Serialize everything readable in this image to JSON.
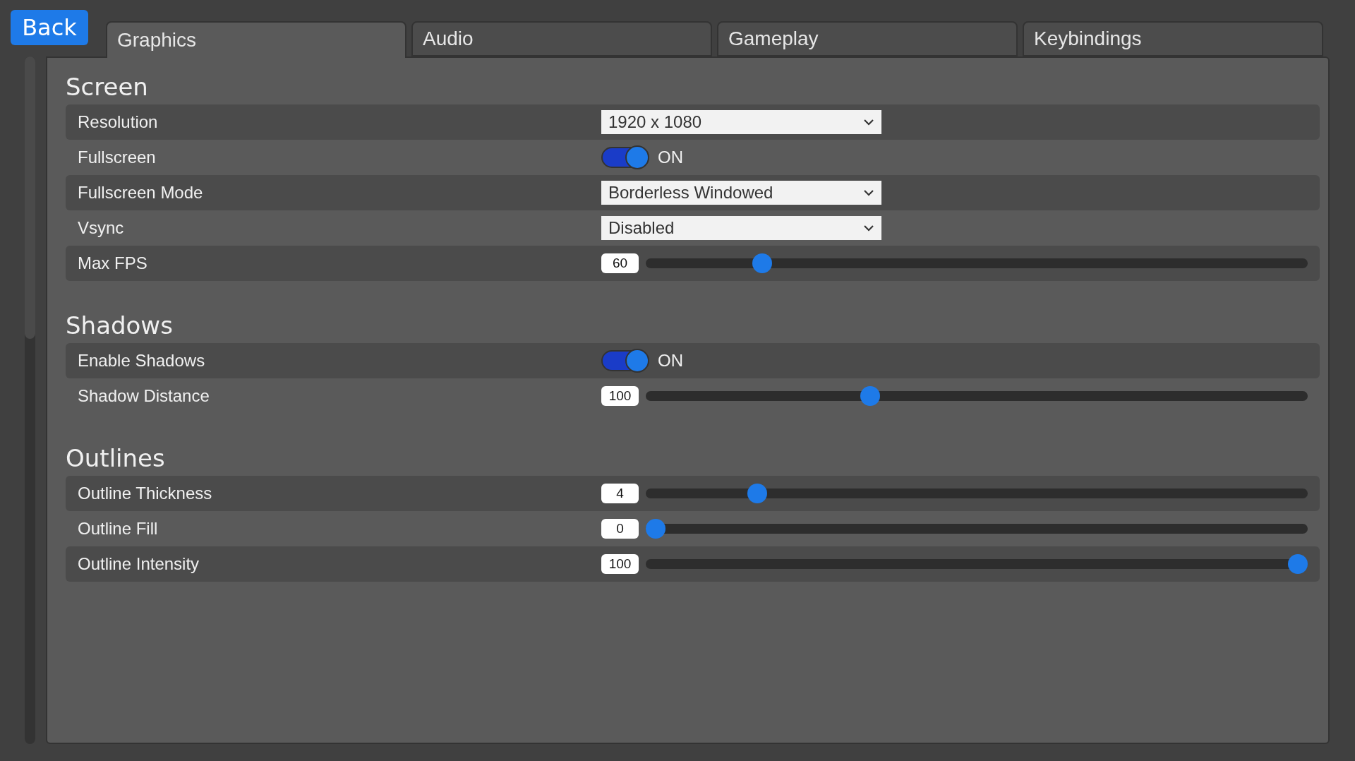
{
  "back_button": {
    "label": "Back"
  },
  "tabs": [
    {
      "label": "Graphics",
      "selected": true
    },
    {
      "label": "Audio",
      "selected": false
    },
    {
      "label": "Gameplay",
      "selected": false
    },
    {
      "label": "Keybindings",
      "selected": false
    }
  ],
  "sections": [
    {
      "title": "Screen",
      "rows": [
        {
          "kind": "dropdown",
          "label": "Resolution",
          "value": "1920 x 1080"
        },
        {
          "kind": "toggle",
          "label": "Fullscreen",
          "on": true,
          "state_label": "ON"
        },
        {
          "kind": "dropdown",
          "label": "Fullscreen Mode",
          "value": "Borderless Windowed"
        },
        {
          "kind": "dropdown",
          "label": "Vsync",
          "value": "Disabled"
        },
        {
          "kind": "slider",
          "label": "Max FPS",
          "reading": "60",
          "level": 0.166
        }
      ]
    },
    {
      "title": "Shadows",
      "rows": [
        {
          "kind": "toggle",
          "label": "Enable Shadows",
          "on": true,
          "state_label": "ON"
        },
        {
          "kind": "slider",
          "label": "Shadow Distance",
          "reading": "100",
          "level": 0.334
        }
      ]
    },
    {
      "title": "Outlines",
      "rows": [
        {
          "kind": "slider",
          "label": "Outline Thickness",
          "reading": "4",
          "level": 0.158
        },
        {
          "kind": "slider",
          "label": "Outline Fill",
          "reading": "0",
          "level": 0
        },
        {
          "kind": "slider",
          "label": "Outline Intensity",
          "reading": "100",
          "level": 1
        }
      ]
    }
  ]
}
